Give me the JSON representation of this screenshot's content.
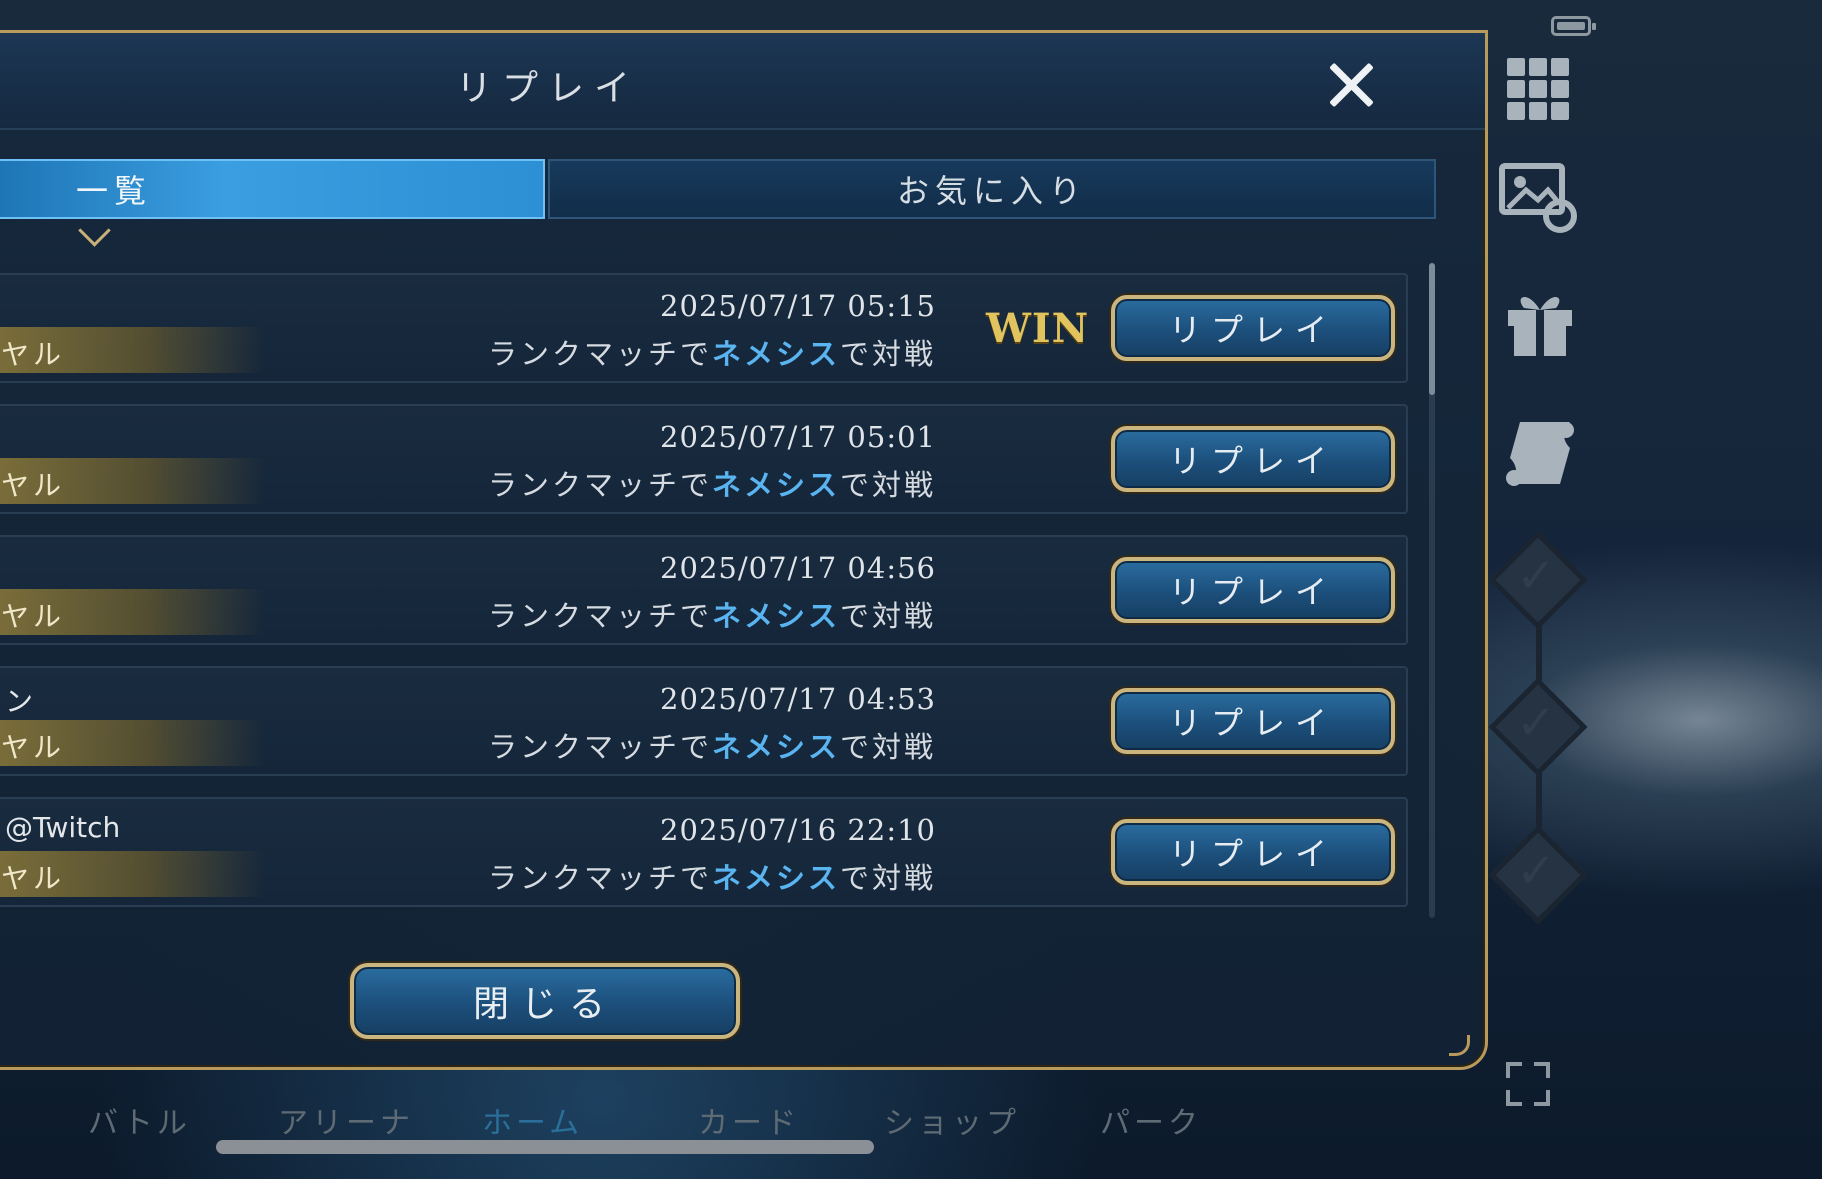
{
  "dialog": {
    "title": "リプレイ",
    "close_icon": "close-icon",
    "tabs": [
      {
        "label": "一覧",
        "active": true
      },
      {
        "label": "お気に入り",
        "active": false
      }
    ],
    "rows": [
      {
        "player": "",
        "rank": "ヤル",
        "date": "2025/07/17 05:15",
        "match_prefix": "ランクマッチで",
        "class_name": "ネメシス",
        "match_suffix": "で対戦",
        "result": "WIN",
        "button": "リプレイ"
      },
      {
        "player": "",
        "rank": "ヤル",
        "date": "2025/07/17 05:01",
        "match_prefix": "ランクマッチで",
        "class_name": "ネメシス",
        "match_suffix": "で対戦",
        "result": "",
        "button": "リプレイ"
      },
      {
        "player": "",
        "rank": "ヤル",
        "date": "2025/07/17 04:56",
        "match_prefix": "ランクマッチで",
        "class_name": "ネメシス",
        "match_suffix": "で対戦",
        "result": "",
        "button": "リプレイ"
      },
      {
        "player": "ン",
        "rank": "ヤル",
        "date": "2025/07/17 04:53",
        "match_prefix": "ランクマッチで",
        "class_name": "ネメシス",
        "match_suffix": "で対戦",
        "result": "",
        "button": "リプレイ"
      },
      {
        "player": "@Twitch",
        "rank": "ヤル",
        "date": "2025/07/16 22:10",
        "match_prefix": "ランクマッチで",
        "class_name": "ネメシス",
        "match_suffix": "で対戦",
        "result": "",
        "button": "リプレイ"
      }
    ],
    "close_button": "閉じる"
  },
  "bottom_nav": {
    "items": [
      "バトル",
      "アリーナ",
      "ホーム",
      "カード",
      "ショップ",
      "パーク"
    ],
    "active": "ホーム"
  },
  "colors": {
    "accent_gold": "#cbb57f",
    "class_blue": "#59b4f0",
    "win_gold": "#e2c45f",
    "tab_active": "#3a9ee0"
  }
}
